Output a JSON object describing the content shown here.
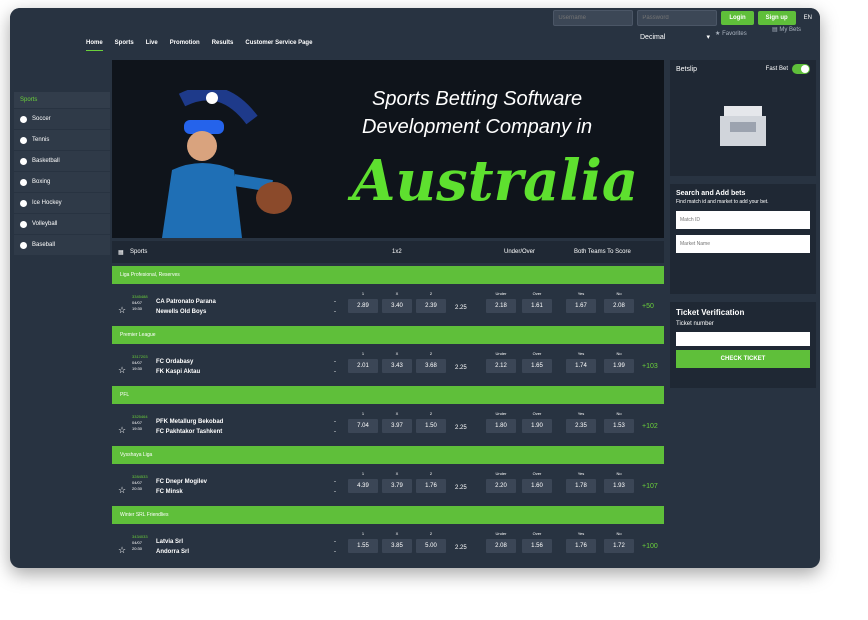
{
  "nav": {
    "items": [
      "Home",
      "Sports",
      "Live",
      "Promotion",
      "Results",
      "Customer Service Page"
    ]
  },
  "auth": {
    "username_placeholder": "Username",
    "password_placeholder": "Password",
    "login": "Login",
    "signup": "Sign up",
    "lang": "EN"
  },
  "toolbar": {
    "odds_format": "Decimal",
    "favorites": "Favorites",
    "my_bets": "My Bets"
  },
  "sidebar": {
    "header": "Sports",
    "items": [
      "Soccer",
      "Tennis",
      "Basketball",
      "Boxing",
      "Ice Hockey",
      "Volleyball",
      "Baseball"
    ]
  },
  "banner": {
    "line1": "Sports Betting Software",
    "line2": "Development Company in",
    "big": "Australia"
  },
  "events_header": {
    "sports": "Sports",
    "one_x_two": "1x2",
    "under_over": "Under/Over",
    "btts": "Both Teams To Score"
  },
  "odd_labels": {
    "one": "1",
    "x": "X",
    "two": "2",
    "under": "Under",
    "over": "Over",
    "yes": "Yes",
    "no": "No"
  },
  "leagues": [
    {
      "name": "Liga Profesional, Reserves",
      "match": {
        "id": "3345488",
        "date": "04/07",
        "time": "19:30",
        "team1": "CA Patronato Parana",
        "team2": "Newells Old Boys",
        "dash1": "-",
        "dash2": "-",
        "o1": "2.89",
        "ox": "3.40",
        "o2": "2.39",
        "hcp": "2.25",
        "under": "2.18",
        "over": "1.61",
        "yes": "1.67",
        "no": "2.08",
        "more": "+50"
      }
    },
    {
      "name": "Premier League",
      "match": {
        "id": "3317203",
        "date": "04/07",
        "time": "19:30",
        "team1": "FC Ordabasy",
        "team2": "FK Kaspi Aktau",
        "dash1": "-",
        "dash2": "-",
        "o1": "2.01",
        "ox": "3.43",
        "o2": "3.68",
        "hcp": "2.25",
        "under": "2.12",
        "over": "1.65",
        "yes": "1.74",
        "no": "1.99",
        "more": "+103"
      }
    },
    {
      "name": "PFL",
      "match": {
        "id": "3325464",
        "date": "04/07",
        "time": "19:30",
        "team1": "PFK Metallurg Bekobad",
        "team2": "FC Pakhtakor Tashkent",
        "dash1": "-",
        "dash2": "-",
        "o1": "7.04",
        "ox": "3.97",
        "o2": "1.50",
        "hcp": "2.25",
        "under": "1.80",
        "over": "1.90",
        "yes": "2.35",
        "no": "1.53",
        "more": "+102"
      }
    },
    {
      "name": "Vysshaya Liga",
      "match": {
        "id": "3284533",
        "date": "04/07",
        "time": "20:30",
        "team1": "FC Dnepr Mogilev",
        "team2": "FC Minsk",
        "dash1": "-",
        "dash2": "-",
        "o1": "4.39",
        "ox": "3.79",
        "o2": "1.76",
        "hcp": "2.25",
        "under": "2.20",
        "over": "1.60",
        "yes": "1.78",
        "no": "1.93",
        "more": "+107"
      }
    },
    {
      "name": "Winter SRL Friendlies",
      "match": {
        "id": "3434033",
        "date": "04/07",
        "time": "20:30",
        "team1": "Latvia Srl",
        "team2": "Andorra Srl",
        "dash1": "-",
        "dash2": "-",
        "o1": "1.55",
        "ox": "3.85",
        "o2": "5.00",
        "hcp": "2.25",
        "under": "2.08",
        "over": "1.56",
        "yes": "1.76",
        "no": "1.72",
        "more": "+100"
      }
    }
  ],
  "betslip": {
    "title": "Betslip",
    "fast_bet": "Fast Bet"
  },
  "search": {
    "title": "Search and Add bets",
    "subtitle": "Find match id and market to add your bet.",
    "match_id_placeholder": "Match ID",
    "market_placeholder": "Market Name"
  },
  "ticket": {
    "title": "Ticket Verification",
    "label": "Ticket number",
    "button": "CHECK TICKET"
  },
  "colors": {
    "accent": "#5fbf3a",
    "panel": "#1f2834",
    "bg": "#283341"
  }
}
